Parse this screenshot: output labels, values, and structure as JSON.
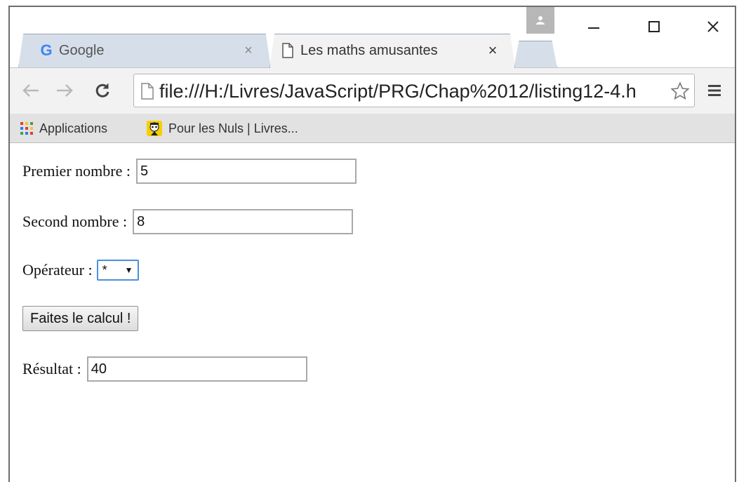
{
  "tabs": [
    {
      "title": "Google",
      "icon": "google-g-icon",
      "close": "×"
    },
    {
      "title": "Les maths amusantes",
      "icon": "page-icon",
      "close": "×"
    }
  ],
  "toolbar": {
    "url": "file:///H:/Livres/JavaScript/PRG/Chap%2012/listing12-4.h"
  },
  "bookmarks": [
    {
      "label": "Applications",
      "icon": "apps-grid-icon"
    },
    {
      "label": "Pour les Nuls | Livres...",
      "icon": "pour-les-nuls-icon"
    }
  ],
  "form": {
    "first_label": "Premier nombre :",
    "first_value": "5",
    "second_label": "Second nombre :",
    "second_value": "8",
    "operator_label": "Opérateur :",
    "operator_value": "*",
    "calc_button": "Faites le calcul !",
    "result_label": "Résultat :",
    "result_value": "40"
  },
  "icons": {
    "google_g": "G",
    "dropdown_arrow": "▼"
  },
  "colors": {
    "tab_inactive": "#d6dfe9",
    "tab_active": "#f2f2f2",
    "toolbar": "#f2f2f2",
    "bookmarks_bar": "#e2e2e2",
    "select_focus": "#4a90d9"
  }
}
